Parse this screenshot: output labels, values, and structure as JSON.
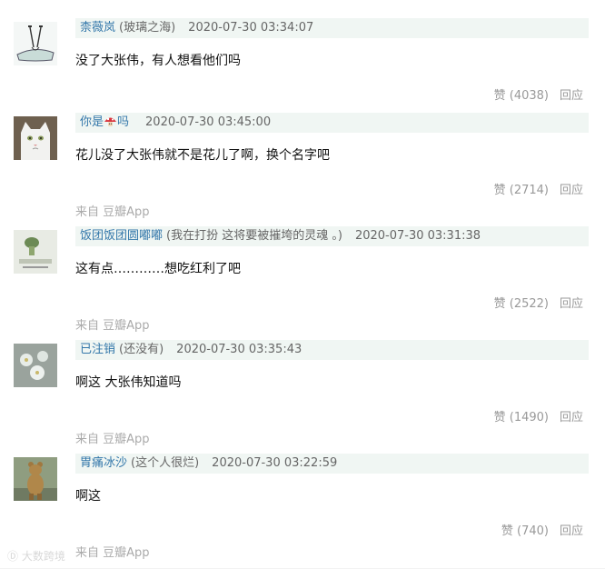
{
  "comments": [
    {
      "author": "柰薇岚",
      "signature": "(玻璃之海)",
      "time": "2020-07-30 03:34:07",
      "content": "没了大张伟，有人想看他们吗",
      "source": "",
      "likes": "赞 (4038)",
      "reply": "回应",
      "avatar_icon": "sketch-figure-avatar"
    },
    {
      "author": "你是",
      "author_suffix": "吗",
      "signature": "",
      "time": "2020-07-30 03:45:00",
      "content": "花儿没了大张伟就不是花儿了啊，换个名字吧",
      "source": "来自 豆瓣App",
      "likes": "赞 (2714)",
      "reply": "回应",
      "avatar_icon": "white-cat-avatar"
    },
    {
      "author": "饭团饭团圆嘟嘟",
      "signature": "(我在打扮 这将要被摧垮的灵魂 。)",
      "time": "2020-07-30 03:31:38",
      "content": "这有点…………想吃红利了吧",
      "source": "来自 豆瓣App",
      "likes": "赞 (2522)",
      "reply": "回应",
      "avatar_icon": "cartoon-avatar"
    },
    {
      "author": "已注销",
      "signature": "(还没有)",
      "time": "2020-07-30 03:35:43",
      "content": "啊这 大张伟知道吗",
      "source": "来自 豆瓣App",
      "likes": "赞 (1490)",
      "reply": "回应",
      "avatar_icon": "flower-avatar"
    },
    {
      "author": "胃痛冰沙",
      "signature": "(这个人很烂)",
      "time": "2020-07-30 03:22:59",
      "content": "啊这",
      "source": "来自 豆瓣App",
      "likes": "赞 (740)",
      "reply": "回应",
      "avatar_icon": "bear-avatar"
    }
  ],
  "watermark": "大数跨境"
}
